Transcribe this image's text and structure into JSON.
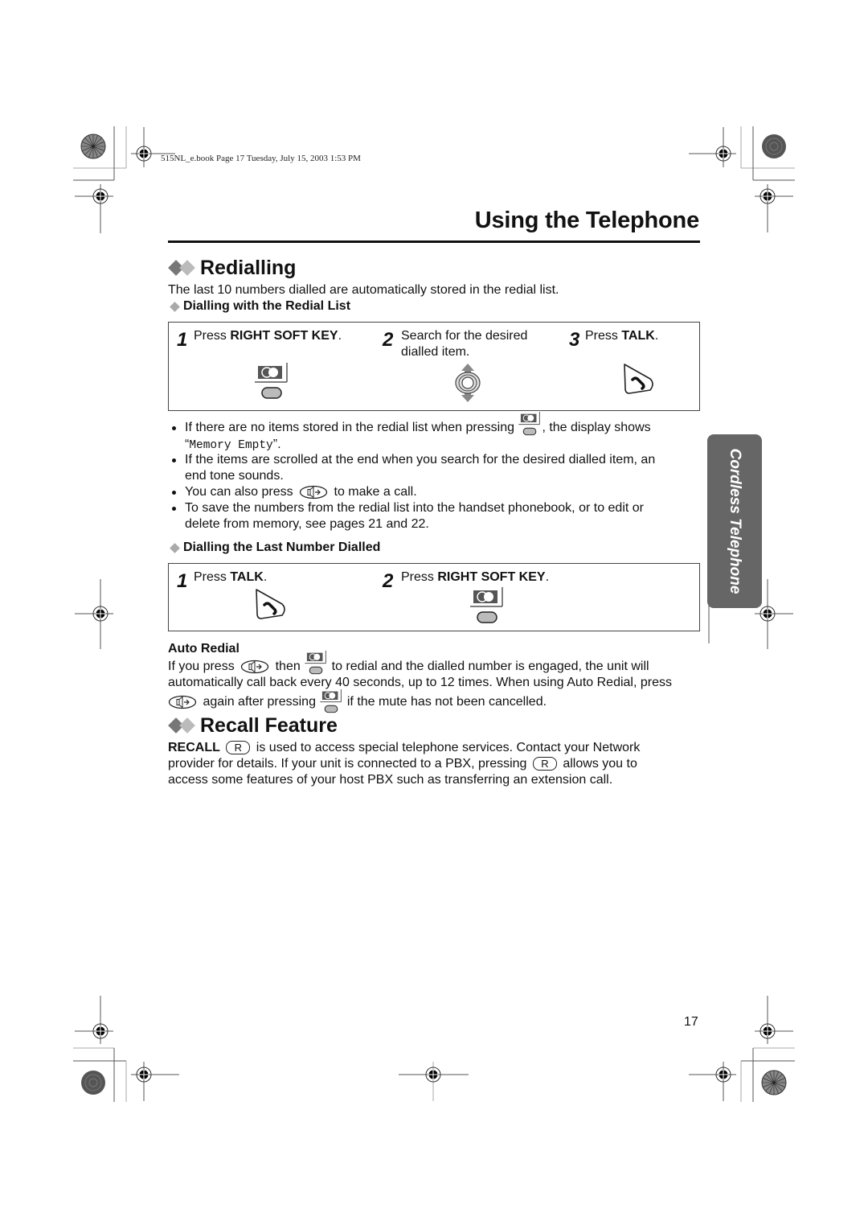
{
  "print_info": "515NL_e.book  Page 17  Tuesday, July 15, 2003  1:53 PM",
  "page_title": "Using the Telephone",
  "side_tab": "Cordless Telephone",
  "page_number": "17",
  "redialling": {
    "heading": "Redialling",
    "intro": "The last 10 numbers dialled are automatically stored in the redial list.",
    "redial_list": {
      "heading": "Dialling with the Redial List",
      "steps": [
        {
          "num": "1",
          "pre": "Press ",
          "bold": "RIGHT SOFT KEY",
          "post": ".",
          "icon": "right-soft-key-icon"
        },
        {
          "num": "2",
          "line1": "Search for the desired",
          "line2": "dialled item.",
          "icon": "navigator-key-icon"
        },
        {
          "num": "3",
          "pre": "Press ",
          "bold": "TALK",
          "post": ".",
          "icon": "talk-key-icon"
        }
      ]
    },
    "notes": [
      {
        "pre": "If there are no items stored in the redial list when pressing ",
        "post": ", the display shows",
        "line2_pre": "“",
        "line2_mono": "Memory Empty",
        "line2_post": "”."
      },
      {
        "line1": "If the items are scrolled at the end when you search for the desired dialled item, an",
        "line2": "end tone sounds."
      },
      {
        "pre": "You can also press ",
        "post": " to make a call."
      },
      {
        "line1": "To save the numbers from the redial list into the handset phonebook, or to edit or",
        "line2": "delete from memory, see pages 21 and 22."
      }
    ],
    "last_number": {
      "heading": "Dialling the Last Number Dialled",
      "steps": [
        {
          "num": "1",
          "pre": "Press ",
          "bold": "TALK",
          "post": ".",
          "icon": "talk-key-icon"
        },
        {
          "num": "2",
          "pre": "Press ",
          "bold": "RIGHT SOFT KEY",
          "post": ".",
          "icon": "right-soft-key-icon"
        }
      ]
    },
    "auto_redial": {
      "heading": "Auto Redial",
      "l1_a": "If you press ",
      "l1_b": " then ",
      "l1_c": " to redial and the dialled number is engaged, the unit will",
      "l2": "automatically call back every 40 seconds, up to 12 times. When using Auto Redial, press",
      "l3_a": " again after pressing ",
      "l3_b": " if the mute has not been cancelled."
    }
  },
  "recall": {
    "heading": "Recall Feature",
    "l1_bold": "RECALL",
    "l1_rest": " is used to access special telephone services. Contact your Network",
    "l2_a": "provider for details. If your unit is connected to a PBX, pressing",
    "l2_b": " allows you to",
    "l3": "access some features of your host PBX such as transferring an extension call.",
    "r_key": "R"
  }
}
